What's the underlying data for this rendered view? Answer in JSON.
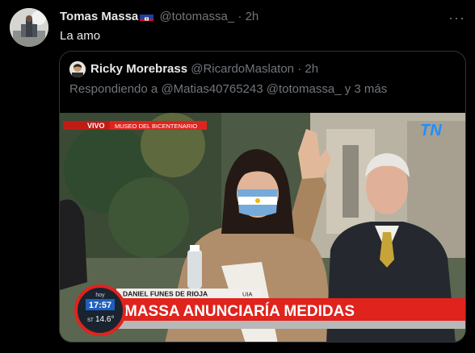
{
  "tweet": {
    "author_name": "Tomas Massa",
    "handle": "@totomassa_",
    "separator": "·",
    "time": "2h",
    "text": "La amo",
    "flag_icon": "haiti-flag-icon"
  },
  "quoted": {
    "author_name": "Ricky Morebrass",
    "handle": "@RicardoMaslaton",
    "separator": "·",
    "time": "2h",
    "reply_prefix": "Respondiendo a ",
    "reply_mention1": "@Matias40765243",
    "reply_mention2": "@totomassa_",
    "reply_suffix": " y 3 más"
  },
  "broadcast": {
    "live_label": "VIVO",
    "location": "MUSEO DEL BICENTENARIO",
    "channel_logo": "TN",
    "speaker_name": "DANIEL FUNES DE RIOJA",
    "speaker_org": "UIA",
    "headline": "MASSA ANUNCIARÍA MEDIDAS",
    "clock_label": "hoy",
    "time": "17:57",
    "temp_label": "ST",
    "temperature": "14.6°"
  },
  "colors": {
    "background": "#000000",
    "text": "#e7e9ea",
    "muted": "#71767b",
    "border": "#2f3336",
    "tn_red": "#e0231d"
  }
}
